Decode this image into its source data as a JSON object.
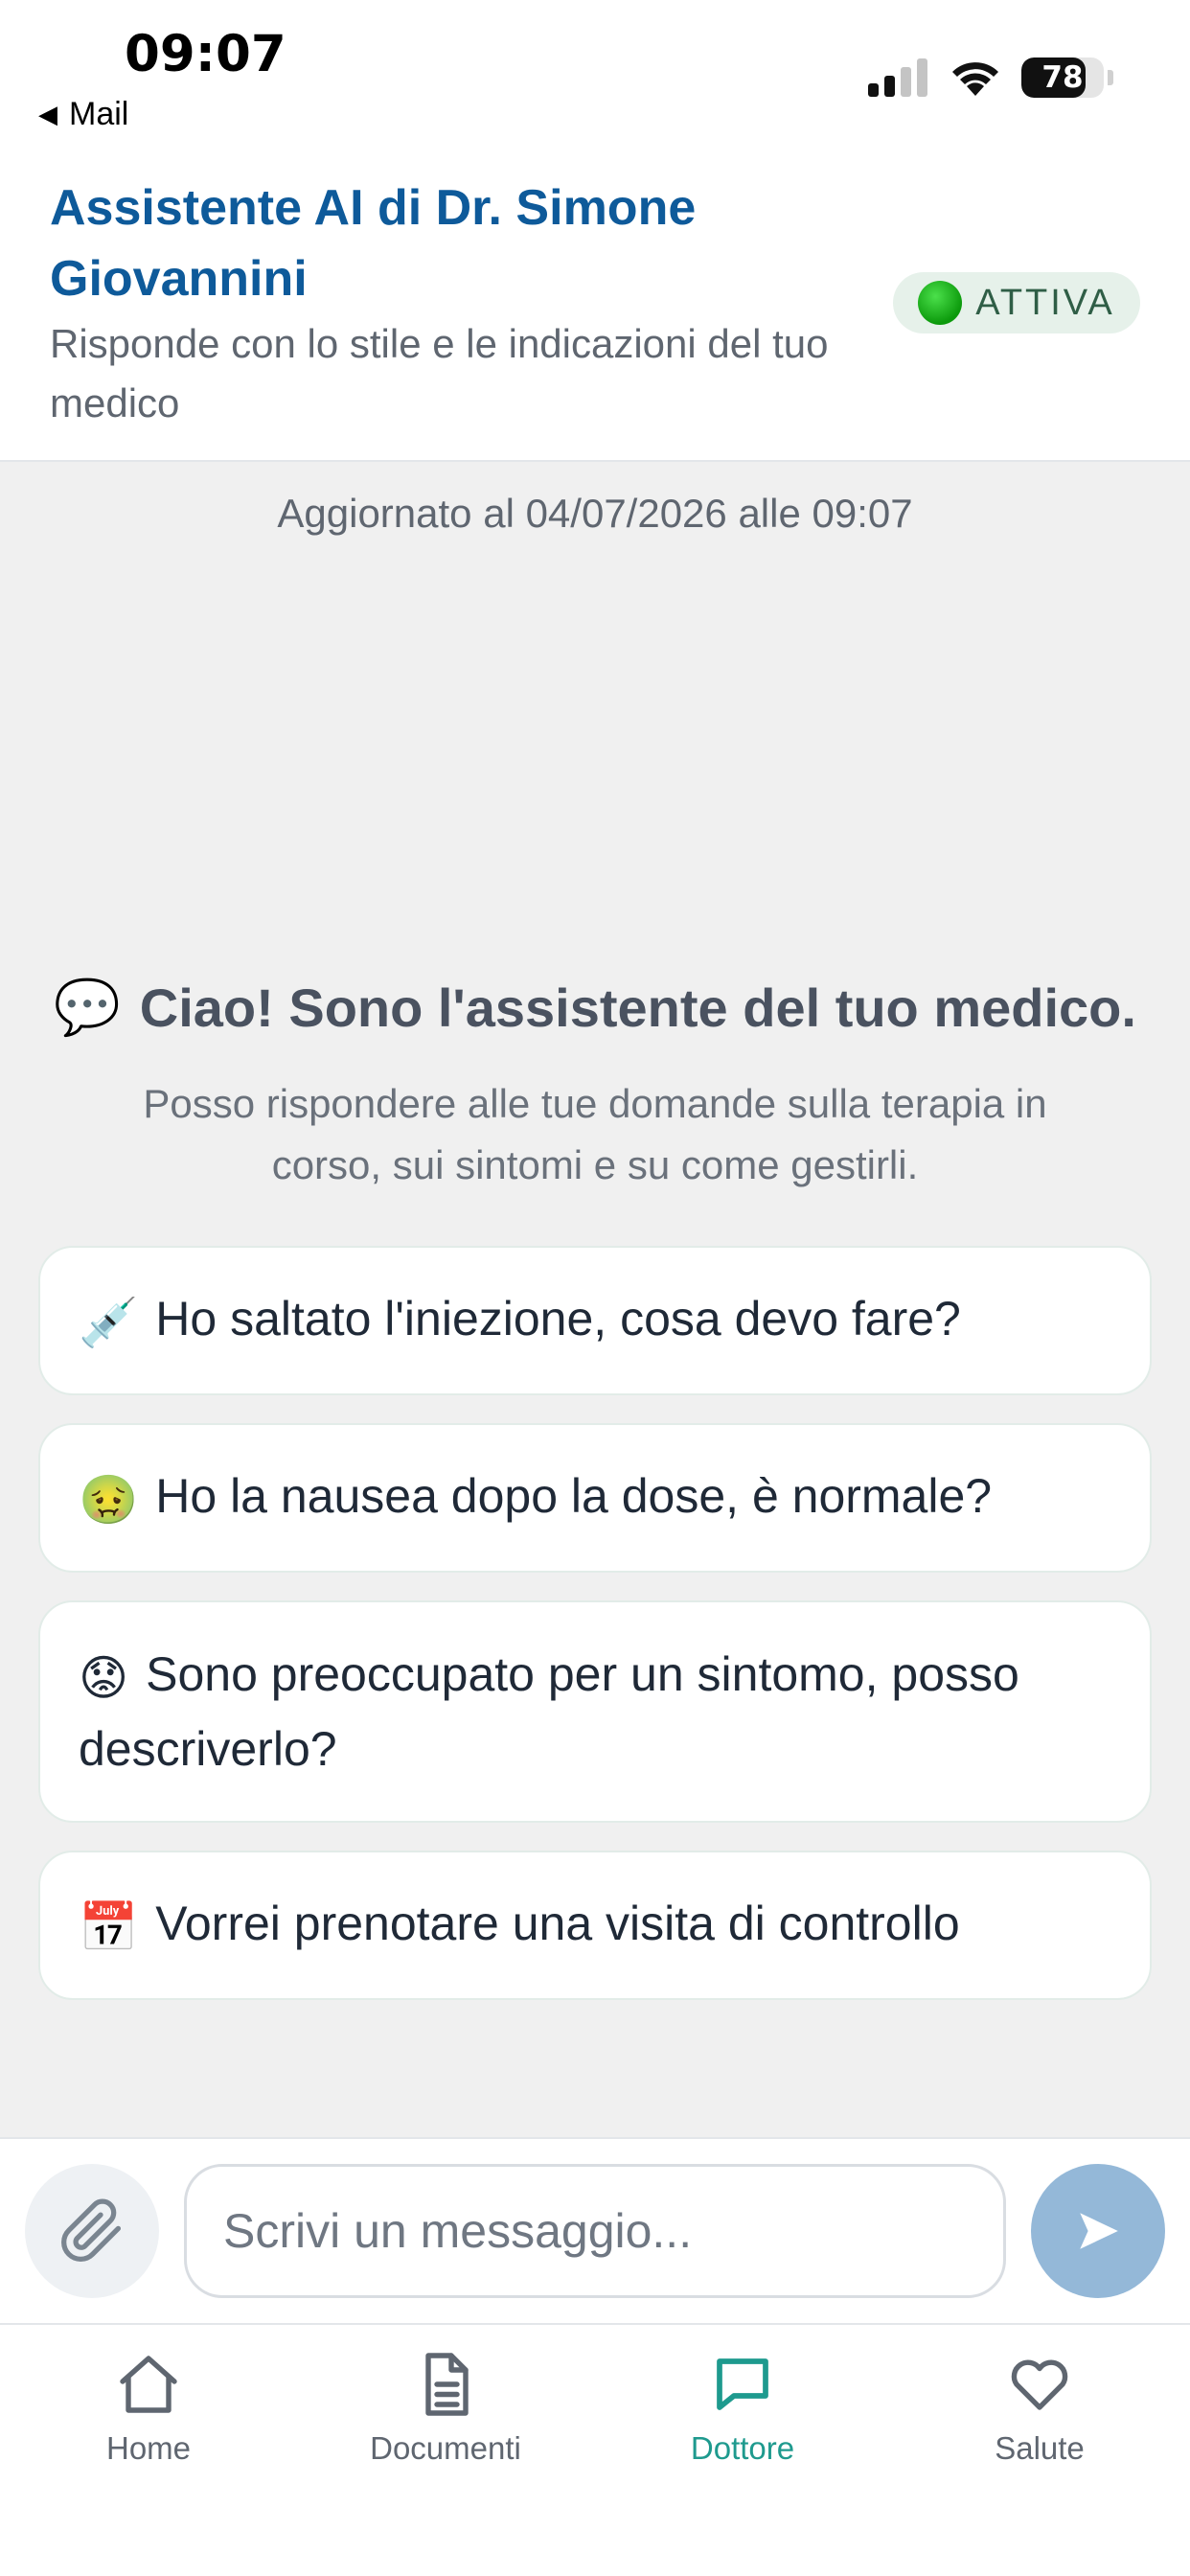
{
  "status_bar": {
    "time": "09:07",
    "back_label": "Mail",
    "battery": "78",
    "battery_level": 0.78,
    "icons": [
      "signal-icon",
      "wifi-icon",
      "battery-icon"
    ]
  },
  "header": {
    "title": "Assistente AI di Dr. Simone Giovannini",
    "subtitle": "Risponde con lo stile e le indicazioni del tuo medico",
    "status_badge": "ATTIVA",
    "status_color": "#11b011"
  },
  "chat": {
    "updated": "Aggiornato al 04/07/2026 alle 09:07",
    "welcome_emoji": "💬",
    "welcome_title": "Ciao! Sono l'assistente del tuo medico.",
    "welcome_subtitle": "Posso rispondere alle tue domande sulla terapia in corso, sui sintomi e su come gestirli.",
    "suggestions": [
      {
        "emoji": "💉",
        "text": "Ho saltato l'iniezione, cosa devo fare?"
      },
      {
        "emoji": "🤢",
        "text": "Ho la nausea dopo la dose, è normale?"
      },
      {
        "emoji": "😟",
        "text": "Sono preoccupato per un sintomo, posso descriverlo?"
      },
      {
        "emoji": "📅",
        "text": "Vorrei prenotare una visita di controllo"
      }
    ]
  },
  "composer": {
    "placeholder": "Scrivi un messaggio...",
    "attach_icon": "paperclip-icon",
    "send_icon": "send-icon"
  },
  "tabbar": {
    "items": [
      {
        "label": "Home",
        "icon": "home-icon",
        "active": false
      },
      {
        "label": "Documenti",
        "icon": "document-icon",
        "active": false
      },
      {
        "label": "Dottore",
        "icon": "chat-icon",
        "active": true
      },
      {
        "label": "Salute",
        "icon": "heart-icon",
        "active": false
      }
    ],
    "active_color": "#1e9a8e",
    "inactive_color": "#5f6670"
  },
  "colors": {
    "brand_blue": "#0e5a9a",
    "background": "#f0f0f0",
    "send_button": "#94b8d8"
  }
}
